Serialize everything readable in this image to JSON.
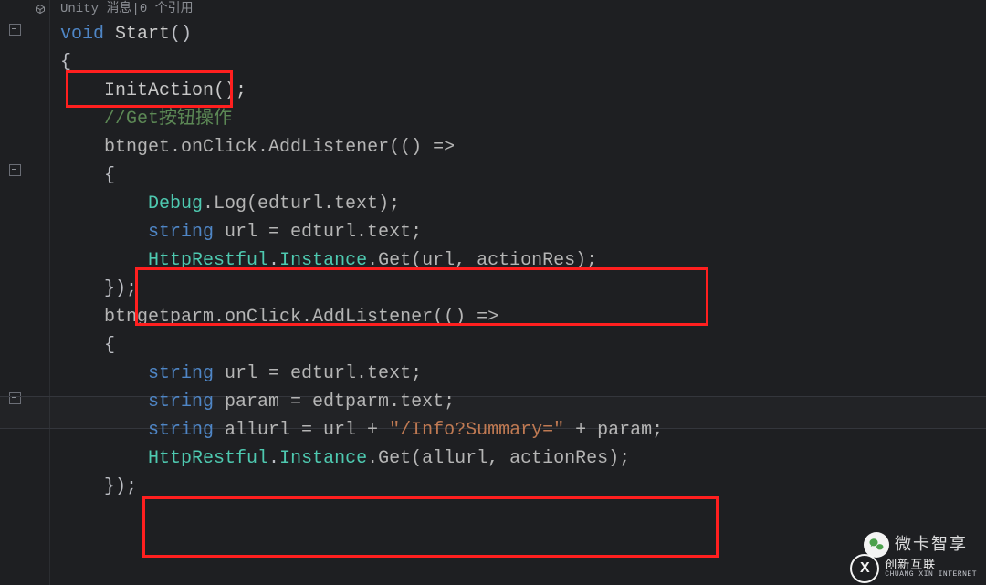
{
  "hint": {
    "source": "Unity",
    "label": "消息",
    "refs": "0 个引用"
  },
  "code": {
    "l0": "void Start()",
    "l1": "{",
    "l2a": "    ",
    "l2b": "InitAction();",
    "l3": "",
    "l4a": "    ",
    "l4b": "//Get按钮操作",
    "l5a": "    btnget.",
    "l5b": "onClick",
    "l5c": ".AddListener(() =>",
    "l6": "    {",
    "l7a": "        ",
    "l7b": "Debug",
    "l7c": ".Log(edturl.text);",
    "l8a": "        ",
    "l8b": "string",
    "l8c": " url = edturl.text;",
    "l9a": "        ",
    "l9b": "HttpRestful",
    "l9c": ".",
    "l9d": "Instance",
    "l9e": ".Get(url, actionRes);",
    "l10": "    });",
    "l11a": "    btngetparm.",
    "l11b": "onClick",
    "l11c": ".AddListener(() =>",
    "l12": "    {",
    "l13a": "        ",
    "l13b": "string",
    "l13c": " url = edturl.text;",
    "l14a": "        ",
    "l14b": "string",
    "l14c": " param = edtparm.text;",
    "l15": "",
    "l16a": "        ",
    "l16b": "string",
    "l16c": " allurl = url + ",
    "l16d": "\"/Info?Summary=\"",
    "l16e": " + param;",
    "l17a": "        ",
    "l17b": "HttpRestful",
    "l17c": ".",
    "l17d": "Instance",
    "l17e": ".Get(allurl, actionRes);",
    "l18": "    });"
  },
  "watermark": "微卡智享",
  "brand": {
    "cn": "创新互联",
    "en": "CHUANG XIN INTERNET"
  }
}
